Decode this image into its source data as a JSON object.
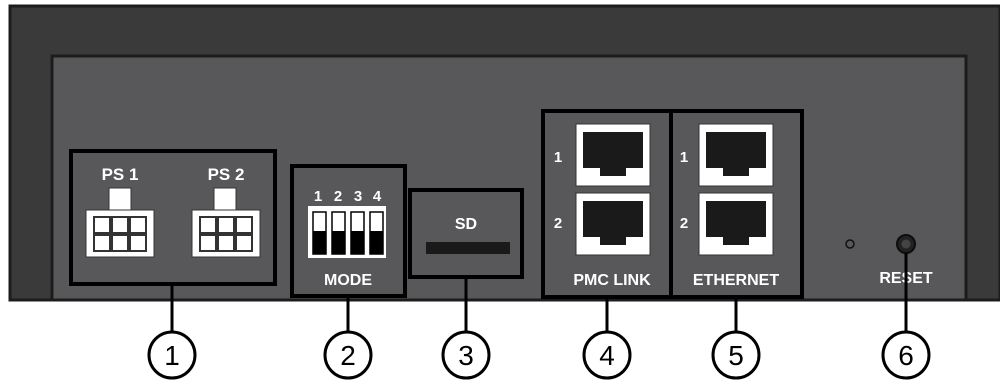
{
  "power": {
    "ps1_label": "PS 1",
    "ps2_label": "PS 2"
  },
  "mode": {
    "label": "MODE",
    "switch_numbers": [
      "1",
      "2",
      "3",
      "4"
    ]
  },
  "sd": {
    "label": "SD"
  },
  "pmc_link": {
    "label": "PMC LINK",
    "port_numbers": [
      "1",
      "2"
    ]
  },
  "ethernet": {
    "label": "ETHERNET",
    "port_numbers": [
      "1",
      "2"
    ]
  },
  "reset": {
    "label": "RESET"
  },
  "callouts": [
    "1",
    "2",
    "3",
    "4",
    "5",
    "6"
  ]
}
